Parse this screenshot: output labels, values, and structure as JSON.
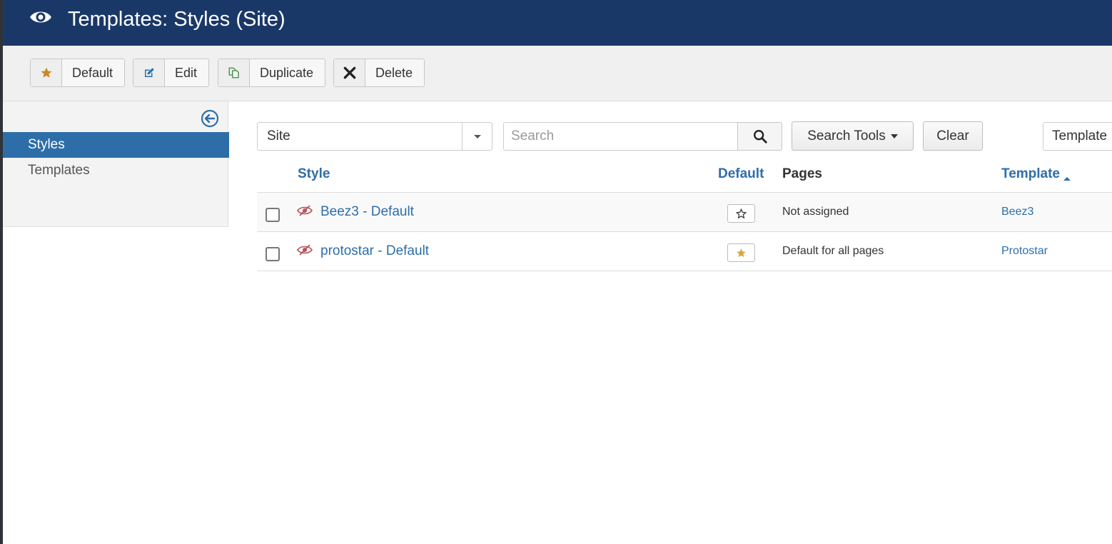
{
  "header": {
    "title": "Templates: Styles (Site)",
    "icon": "eye-icon"
  },
  "toolbar": {
    "default_label": "Default",
    "edit_label": "Edit",
    "duplicate_label": "Duplicate",
    "delete_label": "Delete"
  },
  "sidebar": {
    "items": [
      {
        "label": "Styles",
        "active": true
      },
      {
        "label": "Templates",
        "active": false
      }
    ]
  },
  "filters": {
    "client_value": "Site",
    "search_placeholder": "Search",
    "search_tools_label": "Search Tools",
    "clear_label": "Clear",
    "sort_value": "Template"
  },
  "table": {
    "headers": {
      "style": "Style",
      "default": "Default",
      "pages": "Pages",
      "template": "Template"
    },
    "rows": [
      {
        "style": "Beez3 - Default",
        "is_default": false,
        "pages": "Not assigned",
        "template": "Beez3"
      },
      {
        "style": "protostar - Default",
        "is_default": true,
        "pages": "Default for all pages",
        "template": "Protostar"
      }
    ]
  },
  "colors": {
    "header_bg": "#1a3867",
    "accent": "#2d6ea9",
    "star": "#c98a22",
    "hidden_icon": "#b5545c"
  }
}
